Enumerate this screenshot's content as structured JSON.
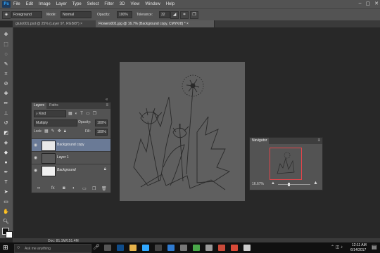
{
  "app": {
    "logo": "Ps"
  },
  "menu": [
    "File",
    "Edit",
    "Image",
    "Layer",
    "Type",
    "Select",
    "Filter",
    "3D",
    "View",
    "Window",
    "Help"
  ],
  "window_controls": [
    "–",
    "▢",
    "✕"
  ],
  "options": {
    "brush_preset": "Foreground",
    "mode_label": "Mode:",
    "mode_value": "Normal",
    "opacity_label": "Opacity:",
    "opacity_value": "100%",
    "tolerance_label": "Tolerance:",
    "tolerance_value": "32"
  },
  "tabs": [
    {
      "label": "gtuto001.psd @ 25% (Layer 97, RGB/8*)",
      "active": false
    },
    {
      "label": "Flowers001.jpg @ 16.7% (Background copy, CMYK/8) *",
      "active": true
    }
  ],
  "layers_panel": {
    "tabs": [
      "Layers",
      "Paths"
    ],
    "kind": "Kind",
    "blend_mode": "Multiply",
    "opacity_label": "Opacity:",
    "opacity_value": "100%",
    "lock_label": "Lock:",
    "fill_label": "Fill:",
    "fill_value": "100%",
    "layers": [
      {
        "name": "Background copy",
        "selected": true
      },
      {
        "name": "Layer 1",
        "selected": false
      },
      {
        "name": "Background",
        "selected": false
      }
    ]
  },
  "navigator": {
    "title": "Navigator",
    "zoom": "16.67%"
  },
  "status": {
    "doc": "Doc: 81.1M/151.4M"
  },
  "taskbar": {
    "search_placeholder": "Ask me anything",
    "time": "12:11 AM",
    "date": "6/14/2017"
  },
  "colors": {
    "accent": "#31a8ff",
    "canvas": "#5f5f5f",
    "nav_frame": "#e0454a"
  }
}
